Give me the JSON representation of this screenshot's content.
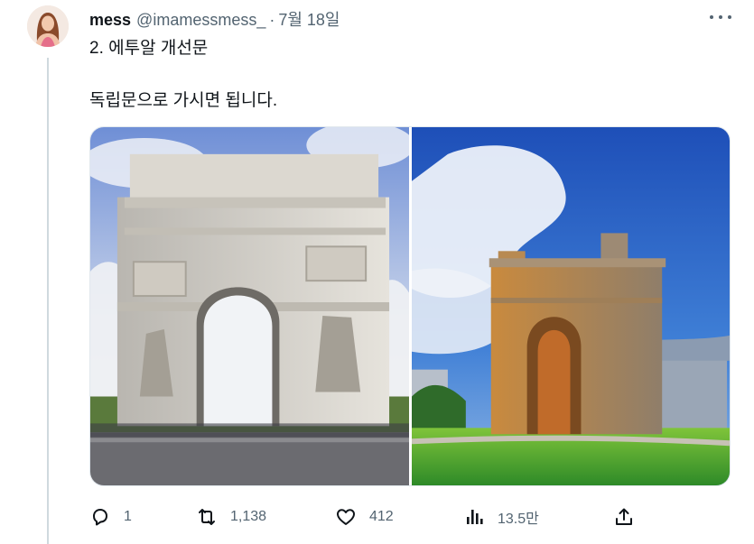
{
  "tweet": {
    "author_name": "mess",
    "author_handle": "@imamessmess_",
    "separator": "·",
    "time": "7월 18일",
    "text_line1": "2. 에투알 개선문",
    "text_line2": "독립문으로 가시면 됩니다."
  },
  "media": {
    "left_image": "arc-de-triomphe-photo",
    "right_image": "independence-gate-photo"
  },
  "actions": {
    "reply_count": "1",
    "retweet_count": "1,138",
    "like_count": "412",
    "views_count": "13.5만"
  },
  "colors": {
    "text": "#0f1419",
    "secondary": "#536471",
    "thread_line": "#cfd9de"
  }
}
